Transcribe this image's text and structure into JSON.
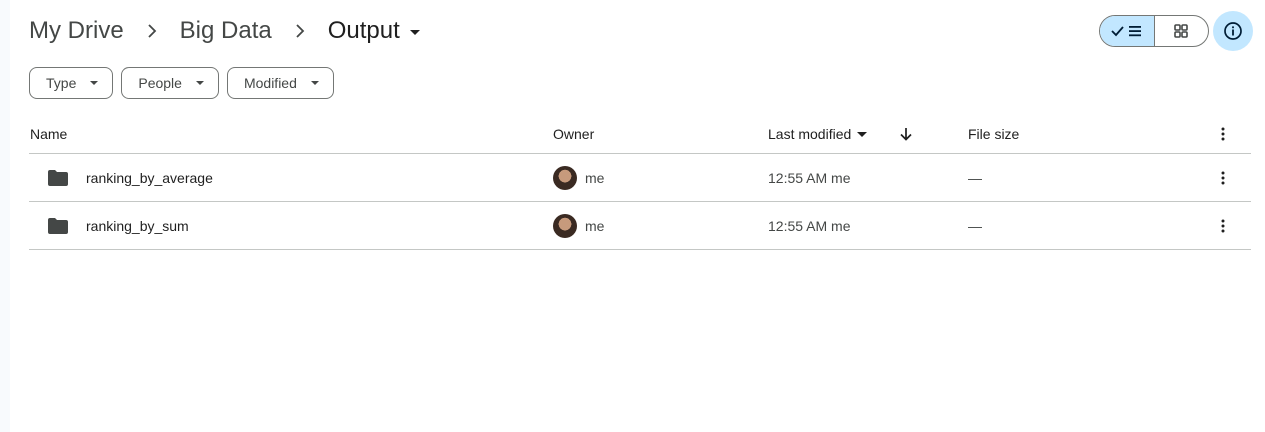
{
  "breadcrumb": {
    "items": [
      "My Drive",
      "Big Data"
    ],
    "current": "Output"
  },
  "view_toggle": {
    "list_icon": "check-list-icon",
    "grid_icon": "grid-icon"
  },
  "info_icon": "info-icon",
  "filters": [
    {
      "label": "Type"
    },
    {
      "label": "People"
    },
    {
      "label": "Modified"
    }
  ],
  "table": {
    "headers": {
      "name": "Name",
      "owner": "Owner",
      "last_modified": "Last modified",
      "file_size": "File size"
    },
    "rows": [
      {
        "name": "ranking_by_average",
        "owner": "me",
        "modified": "12:55 AM me",
        "size": "—"
      },
      {
        "name": "ranking_by_sum",
        "owner": "me",
        "modified": "12:55 AM me",
        "size": "—"
      }
    ]
  },
  "colors": {
    "accent": "#c2e7ff",
    "border": "#c4c7c5",
    "text": "#1f1f1f",
    "muted": "#444746"
  }
}
